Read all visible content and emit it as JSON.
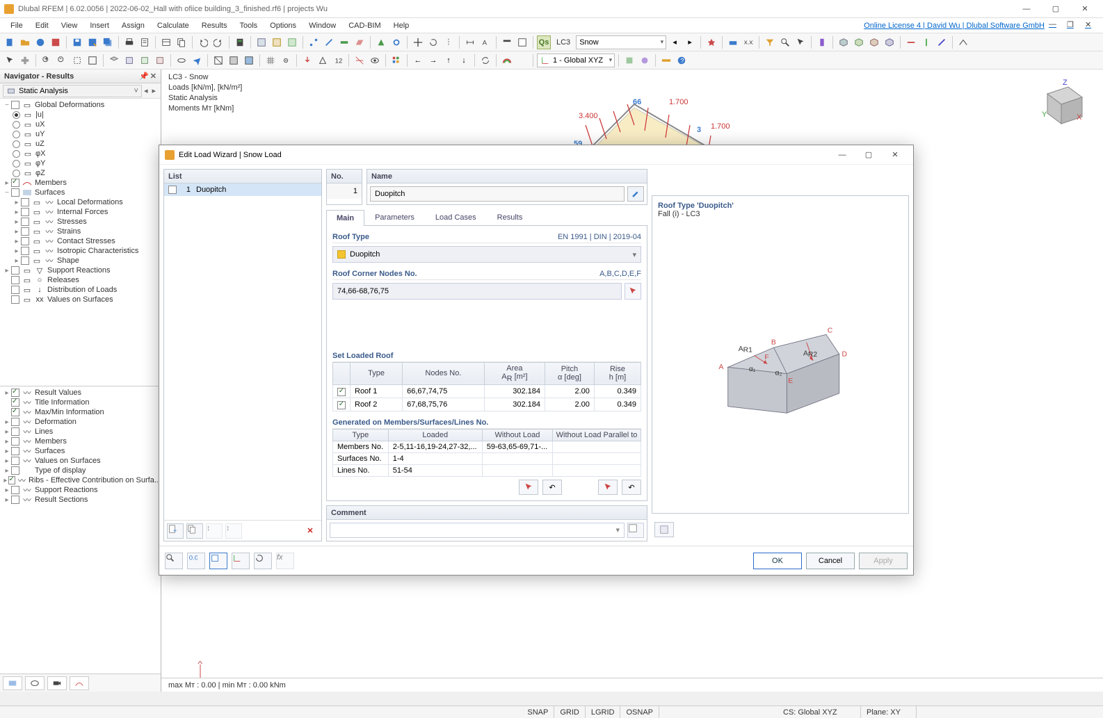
{
  "window": {
    "title": "Dlubal RFEM | 6.02.0056 | 2022-06-02_Hall with ofiice building_3_finished.rf6 | projects Wu",
    "license": "Online License 4 | David Wu | Dlubal Software GmbH"
  },
  "menu": [
    "File",
    "Edit",
    "View",
    "Insert",
    "Assign",
    "Calculate",
    "Results",
    "Tools",
    "Options",
    "Window",
    "CAD-BIM",
    "Help"
  ],
  "toolbar1": {
    "lc_badge": "Qs",
    "lc": "LC3",
    "lc_name": "Snow"
  },
  "toolbar2": {
    "cs": "1 - Global XYZ"
  },
  "navigator": {
    "title": "Navigator - Results",
    "combo": "Static Analysis",
    "deform": {
      "root": "Global Deformations",
      "items": [
        "|u|",
        "uX",
        "uY",
        "uZ",
        "φX",
        "φY",
        "φZ"
      ]
    },
    "members": "Members",
    "surfaces_root": "Surfaces",
    "surfaces": [
      "Local Deformations",
      "Internal Forces",
      "Stresses",
      "Strains",
      "Contact Stresses",
      "Isotropic Characteristics",
      "Shape"
    ],
    "others": [
      "Support Reactions",
      "Releases",
      "Distribution of Loads",
      "Values on Surfaces"
    ],
    "options": [
      "Result Values",
      "Title Information",
      "Max/Min Information",
      "Deformation",
      "Lines",
      "Members",
      "Surfaces",
      "Values on Surfaces",
      "Type of display",
      "Ribs - Effective Contribution on Surfa...",
      "Support Reactions",
      "Result Sections"
    ]
  },
  "view": {
    "l1": "LC3 - Snow",
    "l2": "Loads [kN/m], [kN/m²]",
    "l3": "Static Analysis",
    "l4": "Moments Mᴛ [kNm]"
  },
  "dialog": {
    "title": "Edit Load Wizard | Snow Load",
    "list_hdr": "List",
    "list_item_no": "1",
    "list_item": "Duopitch",
    "no_hdr": "No.",
    "no_val": "1",
    "name_hdr": "Name",
    "name_val": "Duopitch",
    "tabs": [
      "Main",
      "Parameters",
      "Load Cases",
      "Results"
    ],
    "roof_type_hdr": "Roof Type",
    "roof_type_std": "EN 1991 | DIN | 2019-04",
    "roof_type_val": "Duopitch",
    "corners_hdr": "Roof Corner Nodes No.",
    "corners_lbl": "A,B,C,D,E,F",
    "corners_val": "74,66-68,76,75",
    "set_roof_hdr": "Set Loaded Roof",
    "roof_cols": [
      "",
      "Type",
      "Nodes No.",
      "Area\nAR [m²]",
      "Pitch\nα [deg]",
      "Rise\nh [m]"
    ],
    "roof_rows": [
      {
        "on": true,
        "type": "Roof 1",
        "nodes": "66,67,74,75",
        "area": "302.184",
        "pitch": "2.00",
        "rise": "0.349"
      },
      {
        "on": true,
        "type": "Roof 2",
        "nodes": "67,68,75,76",
        "area": "302.184",
        "pitch": "2.00",
        "rise": "0.349"
      }
    ],
    "gen_hdr": "Generated on Members/Surfaces/Lines No.",
    "gen_cols": [
      "Type",
      "Loaded",
      "Without Load",
      "Without Load Parallel to"
    ],
    "gen_rows": [
      {
        "type": "Members No.",
        "loaded": "2-5,11-16,19-24,27-32,...",
        "without": "59-63,65-69,71-...",
        "wop": ""
      },
      {
        "type": "Surfaces No.",
        "loaded": "1-4",
        "without": "",
        "wop": ""
      },
      {
        "type": "Lines No.",
        "loaded": "51-54",
        "without": "",
        "wop": ""
      }
    ],
    "comment_hdr": "Comment",
    "info_l1": "Roof Type 'Duopitch'",
    "info_l2": "Fall (i) - LC3",
    "btn_ok": "OK",
    "btn_cancel": "Cancel",
    "btn_apply": "Apply"
  },
  "status1": "max Mᴛ : 0.00 | min Mᴛ : 0.00 kNm",
  "status2": {
    "snap": "SNAP",
    "grid": "GRID",
    "lgrid": "LGRID",
    "osnap": "OSNAP",
    "cs": "CS: Global XYZ",
    "plane": "Plane: XY"
  }
}
